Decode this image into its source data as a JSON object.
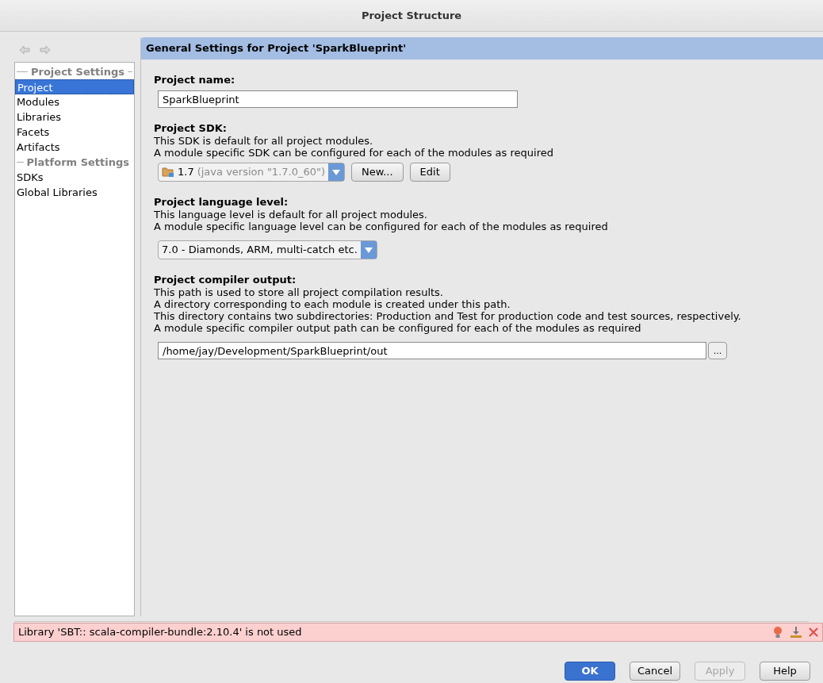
{
  "window": {
    "title": "Project Structure"
  },
  "sidebar": {
    "items": [
      {
        "kind": "header",
        "label": "Project Settings"
      },
      {
        "kind": "item",
        "label": "Project",
        "selected": true
      },
      {
        "kind": "item",
        "label": "Modules",
        "selected": false
      },
      {
        "kind": "item",
        "label": "Libraries",
        "selected": false
      },
      {
        "kind": "item",
        "label": "Facets",
        "selected": false
      },
      {
        "kind": "item",
        "label": "Artifacts",
        "selected": false
      },
      {
        "kind": "header",
        "label": "Platform Settings"
      },
      {
        "kind": "item",
        "label": "SDKs",
        "selected": false
      },
      {
        "kind": "item",
        "label": "Global Libraries",
        "selected": false
      }
    ]
  },
  "panel": {
    "title": "General Settings for Project 'SparkBlueprint'",
    "sections": [
      {
        "kind": "text",
        "label": "Project name:",
        "value": "SparkBlueprint"
      },
      {
        "kind": "sdk",
        "label": "Project SDK:",
        "lines": [
          "This SDK is default for all project modules.",
          "A module specific SDK can be configured for each of the modules as required"
        ],
        "value": "1.7",
        "detail": "(java version \"1.7.0_60\")",
        "buttons": [
          "New...",
          "Edit"
        ]
      },
      {
        "kind": "select",
        "label": "Project language level:",
        "lines": [
          "This language level is default for all project modules.",
          "A module specific language level can be configured for each of the modules as required"
        ],
        "value": "7.0 - Diamonds, ARM, multi-catch etc."
      },
      {
        "kind": "path",
        "label": "Project compiler output:",
        "lines": [
          "This path is used to store all project compilation results.",
          "A directory corresponding to each module is created under this path.",
          "This directory contains two subdirectories: Production and Test for production code and test sources, respectively.",
          "A module specific compiler output path can be configured for each of the modules as required"
        ],
        "value": "/home/jay/Development/SparkBlueprint/out",
        "browse": "..."
      }
    ]
  },
  "problem": {
    "message": "Library 'SBT:: scala-compiler-bundle:2.10.4' is not used"
  },
  "buttons": [
    {
      "label": "OK",
      "default": true,
      "disabled": false
    },
    {
      "label": "Cancel",
      "default": false,
      "disabled": false
    },
    {
      "label": "Apply",
      "default": false,
      "disabled": true
    },
    {
      "label": "Help",
      "default": false,
      "disabled": false
    }
  ]
}
